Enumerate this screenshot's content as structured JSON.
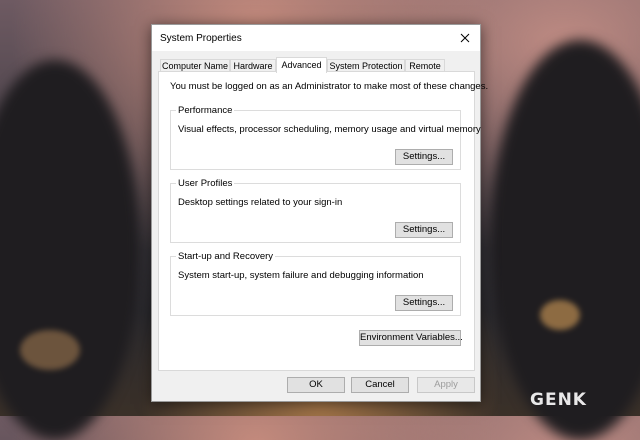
{
  "window": {
    "title": "System Properties"
  },
  "tabs": [
    {
      "label": "Computer Name"
    },
    {
      "label": "Hardware"
    },
    {
      "label": "Advanced",
      "active": true
    },
    {
      "label": "System Protection"
    },
    {
      "label": "Remote"
    }
  ],
  "notice": "You must be logged on as an Administrator to make most of these changes.",
  "groups": {
    "performance": {
      "title": "Performance",
      "description": "Visual effects, processor scheduling, memory usage and virtual memory",
      "button": "Settings..."
    },
    "user_profiles": {
      "title": "User Profiles",
      "description": "Desktop settings related to your sign-in",
      "button": "Settings..."
    },
    "startup_recovery": {
      "title": "Start-up and Recovery",
      "description": "System start-up, system failure and debugging information",
      "button": "Settings..."
    }
  },
  "env_button": "Environment Variables...",
  "footer": {
    "ok": "OK",
    "cancel": "Cancel",
    "apply": "Apply",
    "apply_enabled": false
  },
  "watermark": "GENK"
}
